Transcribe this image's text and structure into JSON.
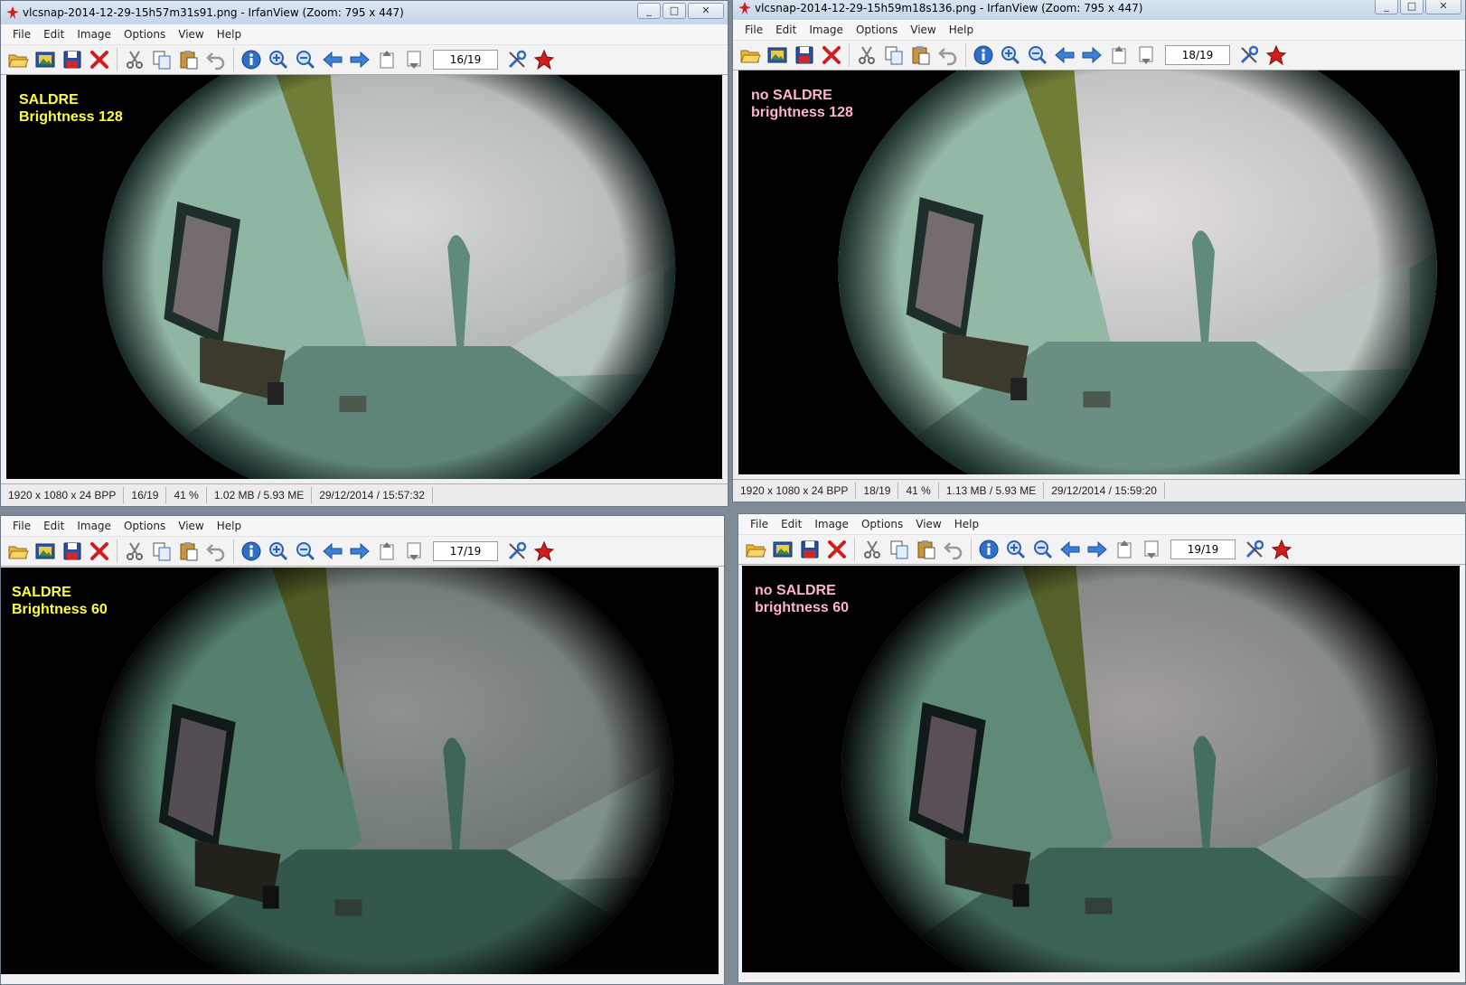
{
  "menu": [
    "File",
    "Edit",
    "Image",
    "Options",
    "View",
    "Help"
  ],
  "window_controls": {
    "minimize": "_",
    "maximize": "□",
    "close": "✕"
  },
  "colors": {
    "label_yellow": "#ffff3c",
    "label_pink": "#ffb3d0",
    "toolbar_blue": "#3e7fd6",
    "red": "#d01e1e"
  },
  "windows": [
    {
      "title": "vlcsnap-2014-12-29-15h57m31s91.png - IrfanView (Zoom: 795 x 447)",
      "page": "16/19",
      "overlay": {
        "line1": "SALDRE",
        "line2": "Brightness 128",
        "color": "#ffff3c"
      },
      "status": {
        "dims": "1920 x 1080 x 24 BPP",
        "index": "16/19",
        "zoom": "41 %",
        "size": "1.02 MB / 5.93 ME",
        "date": "29/12/2014 / 15:57:32"
      }
    },
    {
      "title": "vlcsnap-2014-12-29-15h59m18s136.png - IrfanView (Zoom: 795 x 447)",
      "page": "18/19",
      "overlay": {
        "line1": "no SALDRE",
        "line2": "brightness 128",
        "color": "#ffb3d0"
      },
      "status": {
        "dims": "1920 x 1080 x 24 BPP",
        "index": "18/19",
        "zoom": "41 %",
        "size": "1.13 MB / 5.93 ME",
        "date": "29/12/2014 / 15:59:20"
      }
    },
    {
      "title": "",
      "page": "17/19",
      "overlay": {
        "line1": "SALDRE",
        "line2": "Brightness 60",
        "color": "#ffff3c"
      },
      "status": null
    },
    {
      "title": "",
      "page": "19/19",
      "overlay": {
        "line1": "no SALDRE",
        "line2": "brightness 60",
        "color": "#ffb3d0"
      },
      "status": null
    }
  ]
}
